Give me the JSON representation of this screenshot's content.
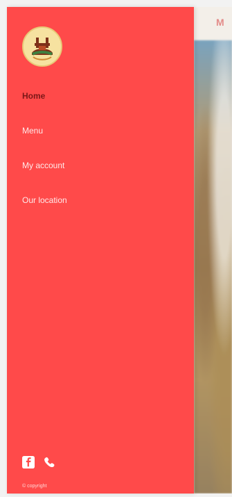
{
  "background": {
    "header_text": "M",
    "colors": {
      "header": "#f3efe9",
      "accent": "#d63b3b"
    }
  },
  "drawer": {
    "background_color": "#ff4a4a",
    "logo": {
      "icon": "restaurant-logo-icon"
    },
    "nav": {
      "items": [
        {
          "label": "Home",
          "active": true
        },
        {
          "label": "Menu",
          "active": false
        },
        {
          "label": "My account",
          "active": false
        },
        {
          "label": "Our location",
          "active": false
        }
      ],
      "active_color": "#7a1717",
      "inactive_color": "#ffe9e9"
    },
    "social": {
      "icons": [
        "facebook-icon",
        "phone-icon"
      ]
    },
    "copyright": "© copyright"
  }
}
